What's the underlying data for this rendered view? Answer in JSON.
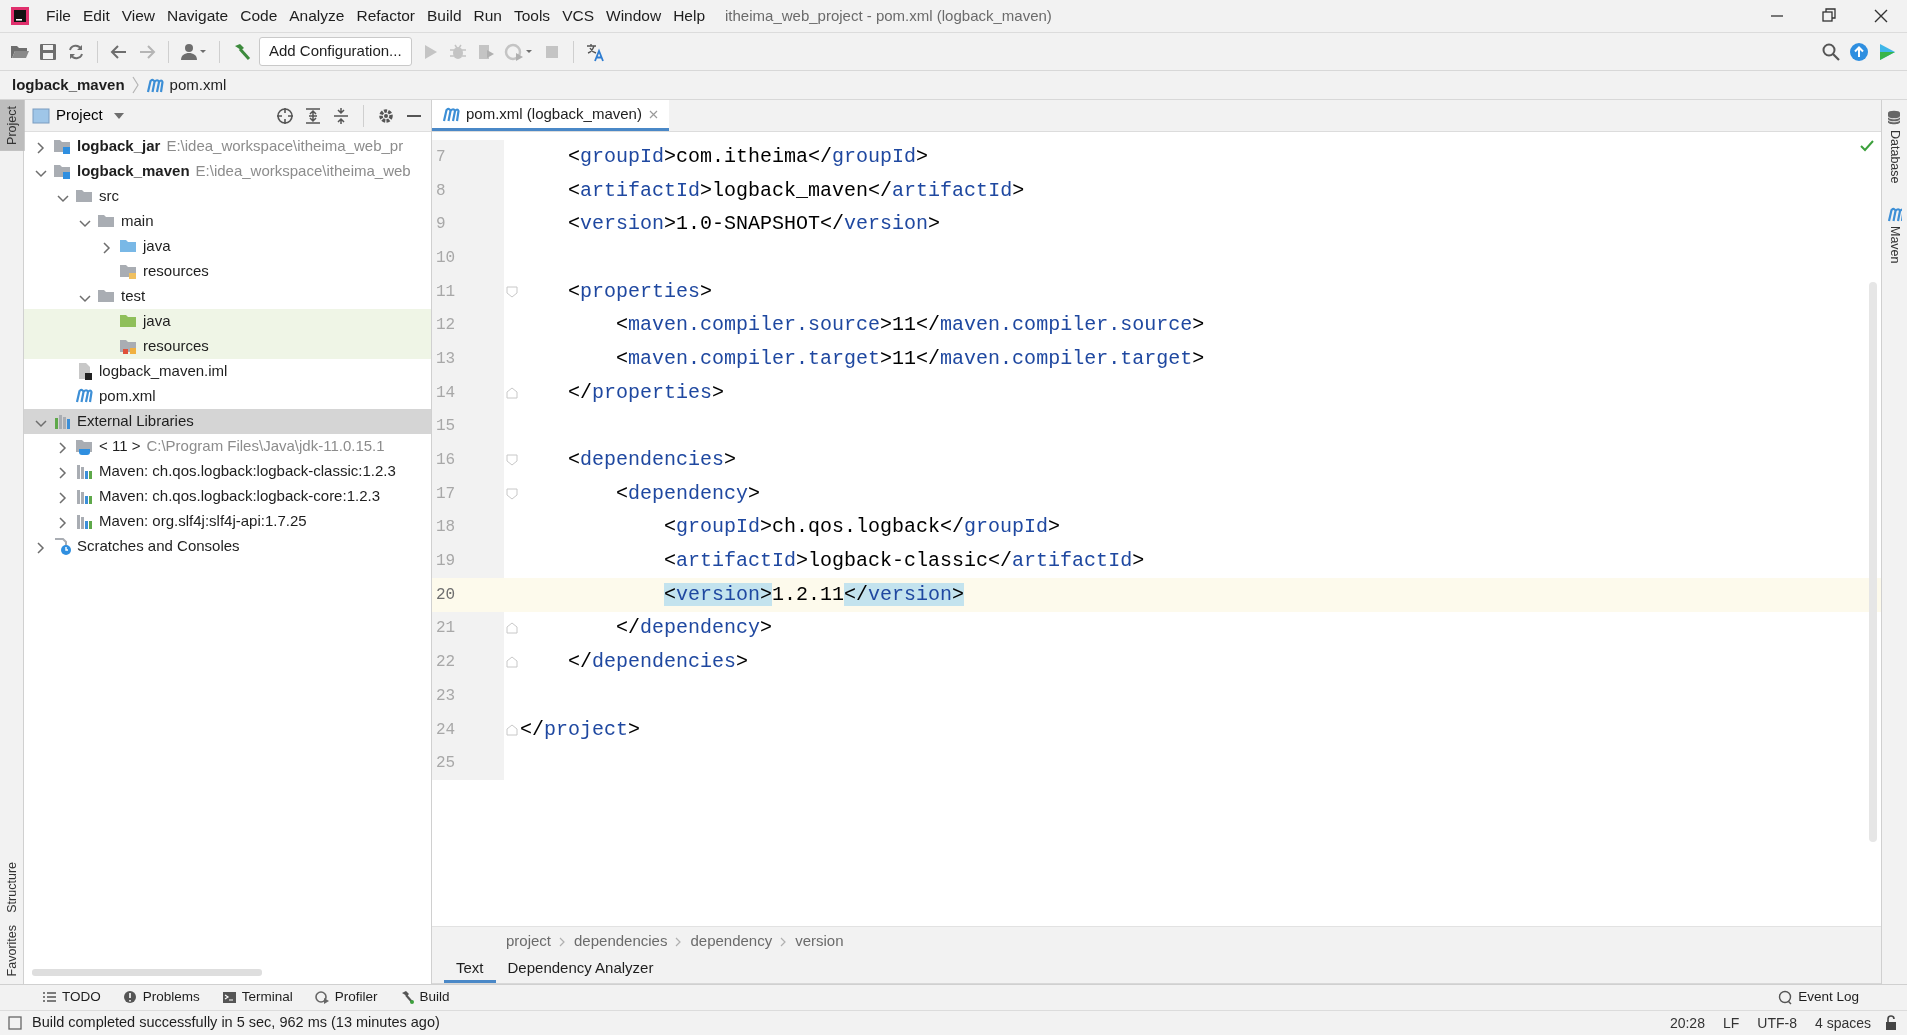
{
  "window": {
    "title": "itheima_web_project - pom.xml (logback_maven)"
  },
  "menu": [
    "File",
    "Edit",
    "View",
    "Navigate",
    "Code",
    "Analyze",
    "Refactor",
    "Build",
    "Run",
    "Tools",
    "VCS",
    "Window",
    "Help"
  ],
  "toolbar": {
    "run_configuration": "Add Configuration..."
  },
  "navigation_bar": [
    "logback_maven",
    "pom.xml"
  ],
  "left_stripe": {
    "top": [
      {
        "label": "Project",
        "selected": true
      }
    ],
    "bottom": [
      {
        "label": "Structure",
        "selected": false
      },
      {
        "label": "Favorites",
        "selected": false
      }
    ]
  },
  "project_panel": {
    "title": "Project",
    "tree": [
      {
        "label": "logback_jar",
        "path": "E:\\idea_workspace\\itheima_web_pr",
        "kind": "module",
        "expanded": false,
        "selected": false
      },
      {
        "label": "logback_maven",
        "path": "E:\\idea_workspace\\itheima_web",
        "kind": "module",
        "expanded": true,
        "selected": false,
        "children": [
          {
            "label": "src",
            "kind": "folder",
            "expanded": true,
            "selected": false,
            "children": [
              {
                "label": "main",
                "kind": "folder",
                "expanded": true,
                "selected": false,
                "children": [
                  {
                    "label": "java",
                    "kind": "source_folder",
                    "expanded": false,
                    "selected": false
                  },
                  {
                    "label": "resources",
                    "kind": "resources_folder",
                    "selected": false
                  }
                ]
              },
              {
                "label": "test",
                "kind": "folder",
                "expanded": true,
                "selected": false,
                "children": [
                  {
                    "label": "java",
                    "kind": "test_source_folder",
                    "selected": false
                  },
                  {
                    "label": "resources",
                    "kind": "test_resources_folder",
                    "selected": false
                  }
                ]
              }
            ]
          },
          {
            "label": "logback_maven.iml",
            "kind": "iml",
            "selected": false
          },
          {
            "label": "pom.xml",
            "kind": "maven_file",
            "selected": false
          }
        ]
      },
      {
        "label": "External Libraries",
        "kind": "libraries",
        "expanded": true,
        "selected": true,
        "children": [
          {
            "label": "< 11 >",
            "path": "C:\\Program Files\\Java\\jdk-11.0.15.1",
            "kind": "jdk",
            "expanded": false,
            "selected": false
          },
          {
            "label": "Maven: ch.qos.logback:logback-classic:1.2.3",
            "kind": "library",
            "expanded": false,
            "selected": false
          },
          {
            "label": "Maven: ch.qos.logback:logback-core:1.2.3",
            "kind": "library",
            "expanded": false,
            "selected": false
          },
          {
            "label": "Maven: org.slf4j:slf4j-api:1.7.25",
            "kind": "library",
            "expanded": false,
            "selected": false
          }
        ]
      },
      {
        "label": "Scratches and Consoles",
        "kind": "scratches",
        "expanded": false,
        "selected": false
      }
    ]
  },
  "editor": {
    "tabs": [
      {
        "label": "pom.xml (logback_maven)",
        "selected": true
      }
    ],
    "lines": [
      {
        "number": "7",
        "code": "    <groupId>com.itheima</groupId>",
        "current": false,
        "tags_highlighted": false
      },
      {
        "number": "8",
        "code": "    <artifactId>logback_maven</artifactId>",
        "current": false,
        "tags_highlighted": false
      },
      {
        "number": "9",
        "code": "    <version>1.0-SNAPSHOT</version>",
        "current": false,
        "tags_highlighted": false
      },
      {
        "number": "10",
        "current": false
      },
      {
        "number": "11",
        "code": "    <properties>",
        "fold_start": true,
        "current": false,
        "tags_highlighted": false
      },
      {
        "number": "12",
        "code": "        <maven.compiler.source>11</maven.compiler.source>",
        "current": false,
        "tags_highlighted": false
      },
      {
        "number": "13",
        "code": "        <maven.compiler.target>11</maven.compiler.target>",
        "current": false,
        "tags_highlighted": false
      },
      {
        "number": "14",
        "code": "    </properties>",
        "fold_end": true,
        "current": false,
        "tags_highlighted": false
      },
      {
        "number": "15",
        "current": false
      },
      {
        "number": "16",
        "code": "    <dependencies>",
        "fold_start": true,
        "current": false,
        "tags_highlighted": false
      },
      {
        "number": "17",
        "code": "        <dependency>",
        "fold_start": true,
        "current": false,
        "tags_highlighted": false
      },
      {
        "number": "18",
        "code": "            <groupId>ch.qos.logback</groupId>",
        "current": false,
        "tags_highlighted": false
      },
      {
        "number": "19",
        "code": "            <artifactId>logback-classic</artifactId>",
        "current": false,
        "tags_highlighted": false
      },
      {
        "number": "20",
        "code": "            <version>1.2.11</version>",
        "current": true,
        "tags_highlighted": true
      },
      {
        "number": "21",
        "code": "        </dependency>",
        "fold_end": true,
        "current": false,
        "tags_highlighted": false
      },
      {
        "number": "22",
        "code": "    </dependencies>",
        "fold_end": true,
        "current": false,
        "tags_highlighted": false
      },
      {
        "number": "23",
        "current": false
      },
      {
        "number": "24",
        "code": "</project>",
        "fold_end": true,
        "current": false,
        "tags_highlighted": false
      },
      {
        "number": "25",
        "current": false
      }
    ],
    "breadcrumb": [
      "project",
      "dependencies",
      "dependency",
      "version"
    ],
    "view_tabs": [
      {
        "label": "Text",
        "selected": true
      },
      {
        "label": "Dependency Analyzer",
        "selected": false
      }
    ]
  },
  "right_stripe": [
    "Database",
    "Maven"
  ],
  "tool_windows": [
    "TODO",
    "Problems",
    "Terminal",
    "Profiler",
    "Build"
  ],
  "event_log": "Event Log",
  "status_bar": {
    "message": "Build completed successfully in 5 sec, 962 ms (13 minutes ago)",
    "items": [
      "20:28",
      "LF",
      "UTF-8",
      "4 spaces"
    ]
  }
}
